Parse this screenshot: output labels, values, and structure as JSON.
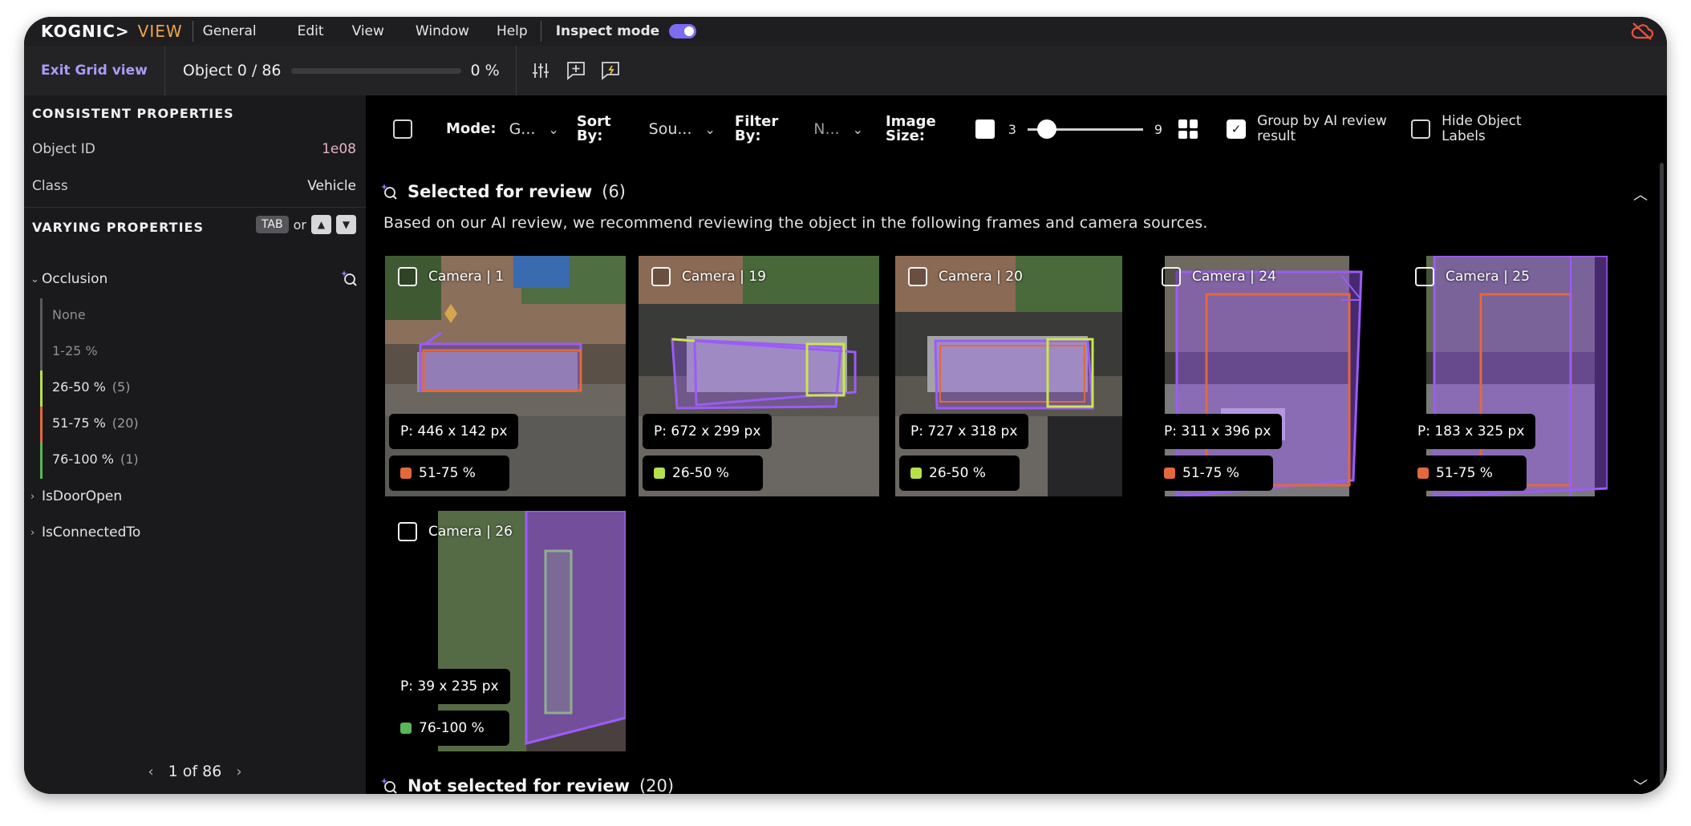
{
  "menubar": {
    "brand_primary": "KOGNIC>",
    "brand_secondary": "VIEW",
    "menu": [
      "General",
      "Edit",
      "View",
      "Window",
      "Help"
    ],
    "inspect_label": "Inspect mode",
    "inspect_on": true,
    "cloud_icon": "cloud-off-icon",
    "cloud_color": "#e8533f"
  },
  "toolbar": {
    "exit_grid_label": "Exit Grid view",
    "object_counter": "Object 0 / 86",
    "progress_percent": 0,
    "progress_label": "0 %",
    "icons": [
      "sliders-icon",
      "add-comment-icon",
      "flag-comment-icon"
    ]
  },
  "sidebar": {
    "consistent_title": "CONSISTENT PROPERTIES",
    "consistent": [
      {
        "key": "Object ID",
        "value": "1e08"
      },
      {
        "key": "Class",
        "value": "Vehicle"
      }
    ],
    "varying_title": "VARYING PROPERTIES",
    "kbd_tab": "TAB",
    "kbd_or": "or",
    "kbd_up": "▲",
    "kbd_down": "▼",
    "occlusion": {
      "label": "Occlusion",
      "options": [
        {
          "label": "None",
          "count": "",
          "color": "#5a5a5e",
          "muted": true
        },
        {
          "label": "1-25 %",
          "count": "",
          "color": "#5a5a5e",
          "muted": true
        },
        {
          "label": "26-50 %",
          "count": "(5)",
          "color": "#b7e04a",
          "muted": false
        },
        {
          "label": "51-75 %",
          "count": "(20)",
          "color": "#e3693c",
          "muted": false
        },
        {
          "label": "76-100 %",
          "count": "(1)",
          "color": "#56b856",
          "muted": false
        }
      ]
    },
    "collapsed_items": [
      "IsDoorOpen",
      "IsConnectedTo"
    ],
    "pager": "1 of 86"
  },
  "controls": {
    "mode_label": "Mode:",
    "mode_value": "G...",
    "sort_label_1": "Sort",
    "sort_label_2": "By:",
    "sort_value": "Sou...",
    "filter_label_1": "Filter",
    "filter_label_2": "By:",
    "filter_value": "N...",
    "image_label_1": "Image",
    "image_label_2": "Size:",
    "size_min": "3",
    "size_max": "9",
    "size_value": 4,
    "group_label": "Group by AI review result",
    "group_checked": true,
    "hide_label": "Hide Object Labels",
    "hide_checked": false
  },
  "sections": {
    "selected_title": "Selected for review",
    "selected_count": "(6)",
    "selected_desc": "Based on our AI review, we recommend reviewing the object in the following frames and camera sources.",
    "not_selected_title": "Not selected for review",
    "not_selected_count": "(20)"
  },
  "tiles": [
    {
      "camera": "Camera | 1",
      "size": "P: 446 x 142 px",
      "occlusion": "51-75 %",
      "occ_color": "#e3693c"
    },
    {
      "camera": "Camera | 19",
      "size": "P: 672 x 299 px",
      "occlusion": "26-50 %",
      "occ_color": "#b7e04a"
    },
    {
      "camera": "Camera | 20",
      "size": "P: 727 x 318 px",
      "occlusion": "26-50 %",
      "occ_color": "#b7e04a"
    },
    {
      "camera": "Camera | 24",
      "size": "P: 311 x 396 px",
      "occlusion": "51-75 %",
      "occ_color": "#e3693c"
    },
    {
      "camera": "Camera | 25",
      "size": "P: 183 x 325 px",
      "occlusion": "51-75 %",
      "occ_color": "#e3693c"
    },
    {
      "camera": "Camera | 26",
      "size": "P: 39 x 235 px",
      "occlusion": "76-100 %",
      "occ_color": "#56b856"
    }
  ],
  "colors": {
    "accent": "#8b7cf5",
    "accent_text": "#a99cf7",
    "bbox_purple": "#9b5cf6",
    "bbox_orange": "#e3693c",
    "bbox_lime": "#c8e84a"
  }
}
